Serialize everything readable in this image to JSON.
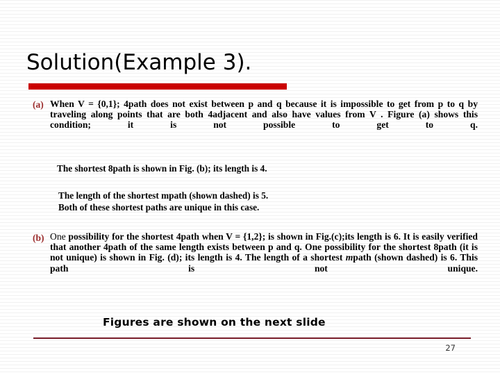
{
  "slide": {
    "title": "Solution(Example 3).",
    "page_number": "27",
    "accent_bar_color": "#CC0000",
    "marker_color": "#9C2B2B",
    "footer_rule_color": "#7A1F2B"
  },
  "items": [
    {
      "marker": "(a)",
      "text": "When V = {0,1}; 4path does not exist between p and q because it is impossible to get from p to q by traveling along points that are both 4adjacent and also have values from V . Figure (a) shows this condition; it is not possible to get to q."
    },
    {
      "marker": "(b)",
      "lead_word": "One",
      "text": "possibility for the shortest 4path when V = {1,2}; is shown in Fig.(c);its length is 6. It is easily verified that another 4path of the same length exists between p and q. One possibility for the shortest 8path (it is not unique) is shown in Fig. (d); its length is 4. The length of a shortest ",
      "italic_letter": "m",
      "text_tail": "path (shown dashed) is 6. This path is not unique."
    }
  ],
  "notes": {
    "line_1": "The shortest 8path is shown in Fig. (b); its length is 4.",
    "line_2": "The length of the shortest mpath (shown dashed) is 5.",
    "line_3": "Both of these shortest paths are unique in this case."
  },
  "footer": {
    "note": "Figures are shown on the next slide"
  }
}
